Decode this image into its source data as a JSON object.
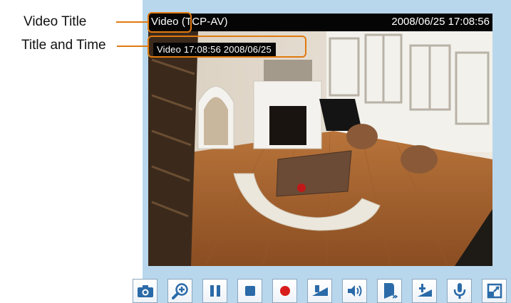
{
  "callouts": {
    "video_title": "Video Title",
    "title_and_time": "Title and Time"
  },
  "viewer": {
    "title": "Video (TCP-AV)",
    "timestamp": "2008/06/25 17:08:56",
    "overlay_text": "Video 17:08:56  2008/06/25"
  },
  "toolbar": [
    {
      "name": "snapshot-button",
      "icon": "camera-icon"
    },
    {
      "name": "digital-zoom-button",
      "icon": "zoom-in-icon"
    },
    {
      "name": "pause-button",
      "icon": "pause-icon"
    },
    {
      "name": "stop-button",
      "icon": "stop-icon"
    },
    {
      "name": "record-button",
      "icon": "record-icon"
    },
    {
      "name": "volume-button",
      "icon": "volume-icon"
    },
    {
      "name": "speaker-button",
      "icon": "speaker-icon"
    },
    {
      "name": "mute-button",
      "icon": "mute-icon"
    },
    {
      "name": "talk-button",
      "icon": "talk-icon"
    },
    {
      "name": "microphone-button",
      "icon": "microphone-icon"
    },
    {
      "name": "fullscreen-button",
      "icon": "fullscreen-icon"
    }
  ],
  "colors": {
    "frame": "#b9d7ec",
    "accent": "#e07a10",
    "icon_blue": "#2a6aa8",
    "record_red": "#d81c1c"
  }
}
